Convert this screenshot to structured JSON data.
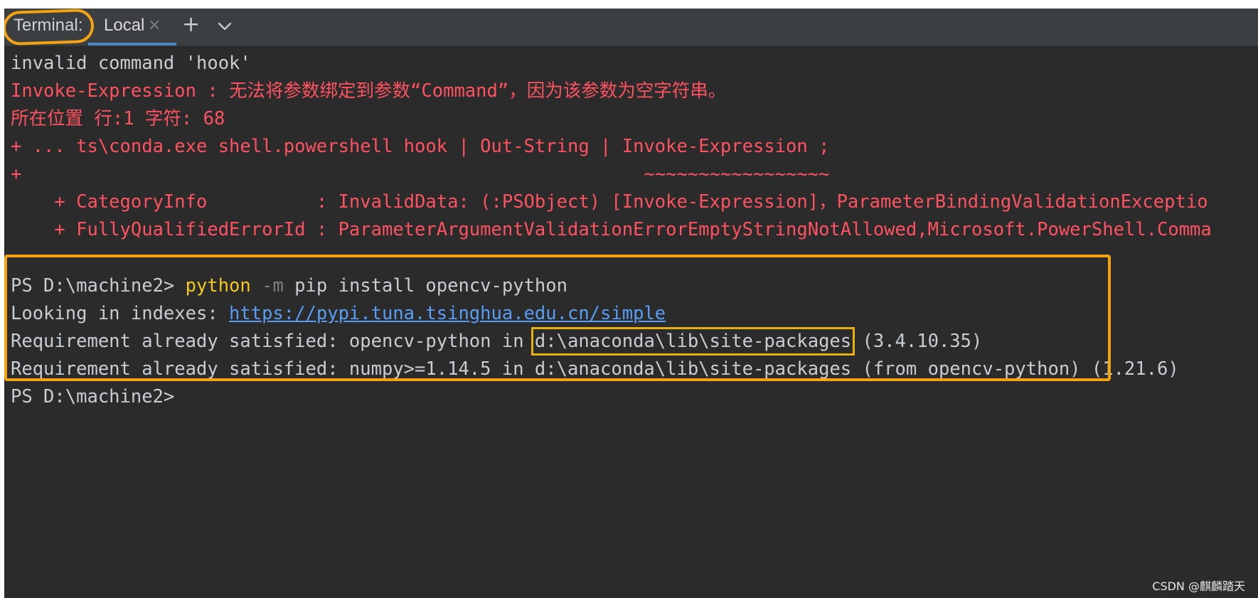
{
  "tabbar": {
    "title": "Terminal:",
    "active_tab": "Local",
    "close_glyph": "×",
    "new_tab_glyph": "+",
    "icons": [
      "close-icon",
      "plus-icon",
      "chevron-down-icon"
    ]
  },
  "terminal": {
    "line1": "invalid command 'hook'",
    "line2": "Invoke-Expression : 无法将参数绑定到参数“Command”，因为该参数为空字符串。",
    "line3": "所在位置 行:1 字符: 68",
    "line4": "+ ... ts\\conda.exe shell.powershell hook | Out-String | Invoke-Expression ;",
    "line5": "+                                                         ~~~~~~~~~~~~~~~~~",
    "line6": "    + CategoryInfo          : InvalidData: (:PSObject) [Invoke-Expression]，ParameterBindingValidationExceptio",
    "line7": "    + FullyQualifiedErrorId : ParameterArgumentValidationErrorEmptyStringNotAllowed,Microsoft.PowerShell.Comma",
    "prompt1": "PS D:\\machine2> ",
    "cmd_python": "python",
    "cmd_flag": " -m",
    "cmd_rest": " pip install opencv-python",
    "idx_prefix": "Looking in indexes: ",
    "idx_url": "https://pypi.tuna.tsinghua.edu.cn/simple",
    "req1_prefix": "Requirement already satisfied: opencv-python in ",
    "req1_path": "d:\\anaconda\\lib\\site-packages",
    "req1_suffix": " (3.4.10.35)",
    "req2": "Requirement already satisfied: numpy>=1.14.5 in d:\\anaconda\\lib\\site-packages (from opencv-python) (1.21.6)",
    "prompt2": "PS D:\\machine2>"
  },
  "colors": {
    "background": "#2b2b2b",
    "tabbar": "#3c3f41",
    "error_text": "#ff5261",
    "command_yellow": "#f5c91d",
    "link_blue": "#589df6",
    "annotation_orange": "#f5a312"
  },
  "watermark": "CSDN @麒麟踏天"
}
